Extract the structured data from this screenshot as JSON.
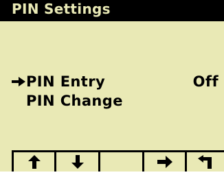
{
  "header": {
    "title": "PIN Settings"
  },
  "menu": {
    "cursor_icon": "right-arrow-cursor-icon",
    "items": [
      {
        "label": "PIN Entry",
        "value": "Off",
        "selected": true
      },
      {
        "label": "PIN Change",
        "value": "",
        "selected": false
      }
    ]
  },
  "softkeys": [
    {
      "name": "up",
      "icon": "arrow-up-icon"
    },
    {
      "name": "down",
      "icon": "arrow-down-icon"
    },
    {
      "name": "blank",
      "icon": ""
    },
    {
      "name": "select",
      "icon": "arrow-right-icon"
    },
    {
      "name": "back",
      "icon": "return-arrow-icon"
    }
  ],
  "colors": {
    "screen_background": "#e9e9b5",
    "foreground": "#000000"
  }
}
